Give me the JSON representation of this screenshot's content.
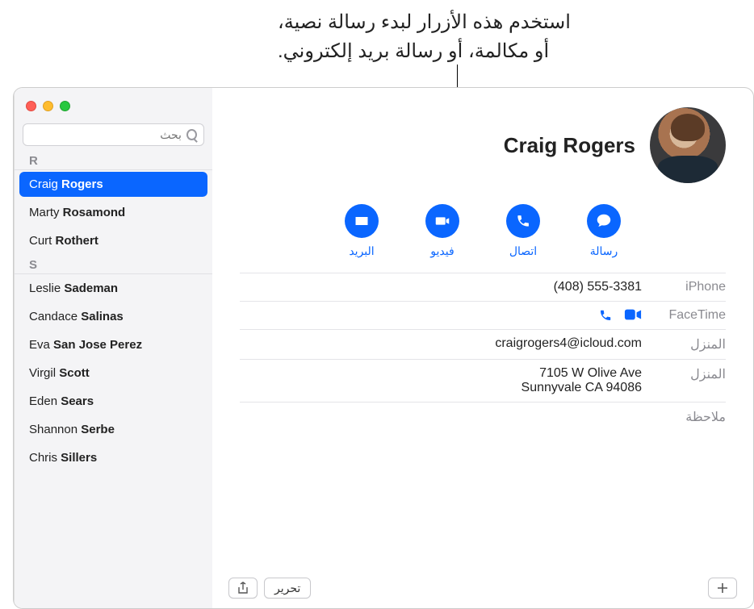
{
  "annotation": {
    "line1": "استخدم هذه الأزرار لبدء رسالة نصية،",
    "line2": "أو مكالمة، أو رسالة بريد إلكتروني."
  },
  "search": {
    "placeholder": "بحث"
  },
  "sections": [
    {
      "letter": "R",
      "items": [
        {
          "first": "Craig",
          "last": "Rogers",
          "selected": true
        },
        {
          "first": "Marty",
          "last": "Rosamond",
          "selected": false
        },
        {
          "first": "Curt",
          "last": "Rothert",
          "selected": false
        }
      ]
    },
    {
      "letter": "S",
      "items": [
        {
          "first": "Leslie",
          "last": "Sademan",
          "selected": false
        },
        {
          "first": "Candace",
          "last": "Salinas",
          "selected": false
        },
        {
          "first": "Eva",
          "last": "San Jose Perez",
          "selected": false
        },
        {
          "first": "Virgil",
          "last": "Scott",
          "selected": false
        },
        {
          "first": "Eden",
          "last": "Sears",
          "selected": false
        },
        {
          "first": "Shannon",
          "last": "Serbe",
          "selected": false
        },
        {
          "first": "Chris",
          "last": "Sillers",
          "selected": false
        }
      ]
    }
  ],
  "card": {
    "name": "Craig Rogers",
    "actions": {
      "message": "رسالة",
      "call": "اتصال",
      "video": "فيديو",
      "mail": "البريد"
    },
    "fields": {
      "phone_label": "iPhone",
      "phone_value": "(408) 555-3381",
      "facetime_label": "FaceTime",
      "email_label": "المنزل",
      "email_value": "craigrogers4@icloud.com",
      "address_label": "المنزل",
      "address_line1": "7105 W Olive Ave",
      "address_line2": "Sunnyvale CA 94086",
      "note_label": "ملاحظة"
    }
  },
  "toolbar": {
    "edit": "تحرير"
  }
}
